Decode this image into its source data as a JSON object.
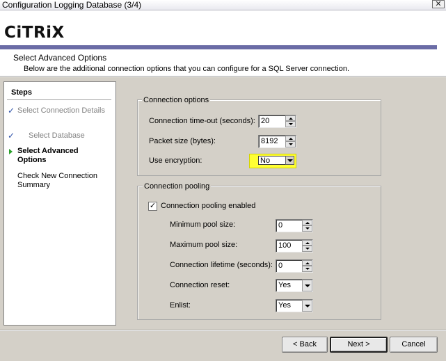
{
  "window": {
    "title": "Configuration Logging Database (3/4)",
    "close_glyph": "✕"
  },
  "header": {
    "logo": "CiTRiX",
    "logo_mark": "®",
    "title": "Select Advanced Options",
    "subtitle": "Below are the additional connection options that you can configure for a SQL Server connection."
  },
  "steps": {
    "heading": "Steps",
    "items": [
      {
        "label": "Select Connection Details",
        "state": "done",
        "icon": "checkmark-icon"
      },
      {
        "label": "Select Database",
        "state": "done",
        "icon": "checkmark-icon"
      },
      {
        "label": "Select Advanced Options",
        "state": "current",
        "icon": "arrow-right-icon"
      },
      {
        "label": "Check New Connection Summary",
        "state": "pending",
        "icon": ""
      }
    ]
  },
  "connection_options": {
    "legend": "Connection options",
    "timeout_label": "Connection time-out (seconds):",
    "timeout_value": "20",
    "packet_label": "Packet size (bytes):",
    "packet_value": "8192",
    "encryption_label": "Use encryption:",
    "encryption_value": "No",
    "highlight_color": "#ffff33"
  },
  "connection_pooling": {
    "legend": "Connection pooling",
    "enabled_label": "Connection pooling enabled",
    "enabled_checked": true,
    "enabled_glyph": "✓",
    "min_label": "Minimum pool size:",
    "min_value": "0",
    "max_label": "Maximum pool size:",
    "max_value": "100",
    "lifetime_label": "Connection lifetime (seconds):",
    "lifetime_value": "0",
    "reset_label": "Connection reset:",
    "reset_value": "Yes",
    "enlist_label": "Enlist:",
    "enlist_value": "Yes"
  },
  "buttons": {
    "back": "< Back",
    "next": "Next >",
    "cancel": "Cancel"
  },
  "colors": {
    "accent_bar": "#6b6ca6",
    "check_blue": "#2c50a8",
    "arrow_green": "#2aa02a"
  }
}
